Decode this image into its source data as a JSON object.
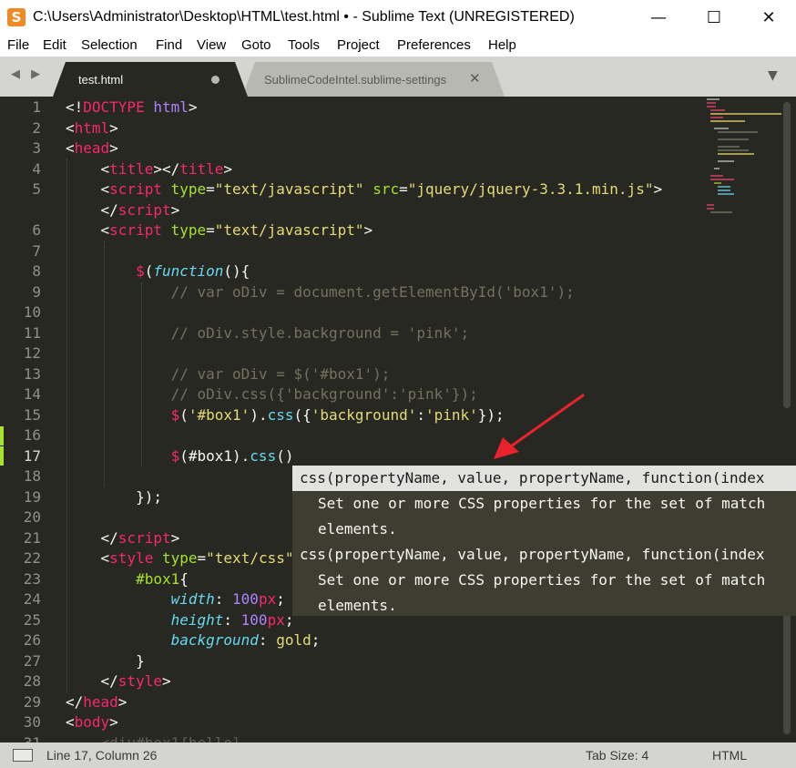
{
  "window": {
    "title": "C:\\Users\\Administrator\\Desktop\\HTML\\test.html • - Sublime Text (UNREGISTERED)",
    "logo_letter": "S",
    "minimize": "—",
    "maximize": "☐",
    "close": "✕"
  },
  "menu": [
    "File",
    "Edit",
    "Selection",
    "Find",
    "View",
    "Goto",
    "Tools",
    "Project",
    "Preferences",
    "Help"
  ],
  "tabs": [
    {
      "label": "test.html",
      "active": true,
      "modified": true
    },
    {
      "label": "SublimeCodeIntel.sublime-settings",
      "active": false,
      "close": "✕"
    }
  ],
  "tab_nav": "◀ ▶",
  "tab_dropdown": "▼",
  "line_numbers": [
    "1",
    "2",
    "3",
    "4",
    "5",
    "",
    "6",
    "7",
    "8",
    "9",
    "10",
    "11",
    "12",
    "13",
    "14",
    "15",
    "16",
    "17",
    "18",
    "19",
    "20",
    "21",
    "22",
    "23",
    "24",
    "25",
    "26",
    "27",
    "28",
    "29",
    "30",
    "31"
  ],
  "autocomplete": {
    "items": [
      {
        "signature": "css(propertyName, value, propertyName, function(index",
        "description_1": "Set one or more CSS properties for the set of match",
        "description_2": "elements.",
        "selected": true
      },
      {
        "signature": "css(propertyName, value, propertyName, function(index",
        "description_1": "Set one or more CSS properties for the set of match",
        "description_2": "elements.",
        "selected": false
      }
    ]
  },
  "status": {
    "position": "Line 17, Column 26",
    "tab_size": "Tab Size: 4",
    "syntax": "HTML"
  },
  "colors": {
    "background": "#272822",
    "tag": "#f92672",
    "attribute": "#a6e22e",
    "string": "#e6db74",
    "comment": "#75715e",
    "number": "#ae81ff",
    "function": "#66d9ef",
    "annotation_arrow": "#e8232e"
  }
}
